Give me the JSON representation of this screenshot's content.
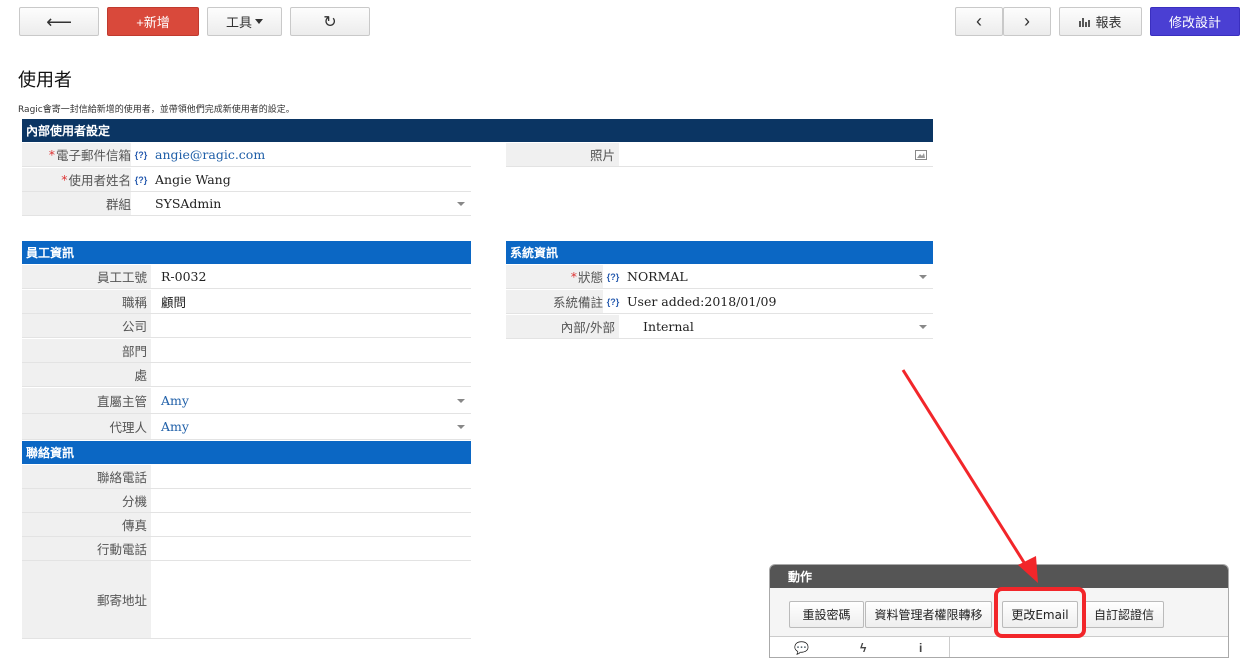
{
  "toolbar": {
    "back": "⟵",
    "new": "+新增",
    "tools": "工具",
    "refresh": "↻",
    "prev": "‹",
    "next": "›",
    "report": "報表",
    "design": "修改設計"
  },
  "page": {
    "title": "使用者",
    "description": "Ragic會寄一封信給新增的使用者，並帶領他們完成新使用者的設定。"
  },
  "internal": {
    "header": "內部使用者設定",
    "email_label": "電子郵件信箱",
    "email_value": "angie@ragic.com",
    "name_label": "使用者姓名",
    "name_value": "Angie Wang",
    "group_label": "群組",
    "group_value": "SYSAdmin",
    "photo_label": "照片"
  },
  "employee": {
    "header": "員工資訊",
    "rows": [
      {
        "label": "員工工號",
        "value": "R-0032"
      },
      {
        "label": "職稱",
        "value": "顧問"
      },
      {
        "label": "公司",
        "value": ""
      },
      {
        "label": "部門",
        "value": ""
      },
      {
        "label": "處",
        "value": ""
      },
      {
        "label": "直屬主管",
        "value": "Amy"
      },
      {
        "label": "代理人",
        "value": "Amy"
      }
    ]
  },
  "system": {
    "header": "系統資訊",
    "status_label": "狀態",
    "status_value": "NORMAL",
    "note_label": "系統備註",
    "note_value": "User added:2018/01/09",
    "inout_label": "內部/外部",
    "inout_value": "Internal"
  },
  "contact": {
    "header": "聯絡資訊",
    "rows": [
      {
        "label": "聯絡電話"
      },
      {
        "label": "分機"
      },
      {
        "label": "傳真"
      },
      {
        "label": "行動電話"
      },
      {
        "label": "郵寄地址"
      }
    ]
  },
  "help_mark": "{?}",
  "actions": {
    "header": "動作",
    "reset_password": "重設密碼",
    "transfer_admin": "資料管理者權限轉移",
    "change_email": "更改Email",
    "custom_verify": "自訂認證信"
  },
  "colors": {
    "highlight": "#f2262a",
    "section_dark": "#0b3563",
    "section_blue": "#0b67c4"
  }
}
